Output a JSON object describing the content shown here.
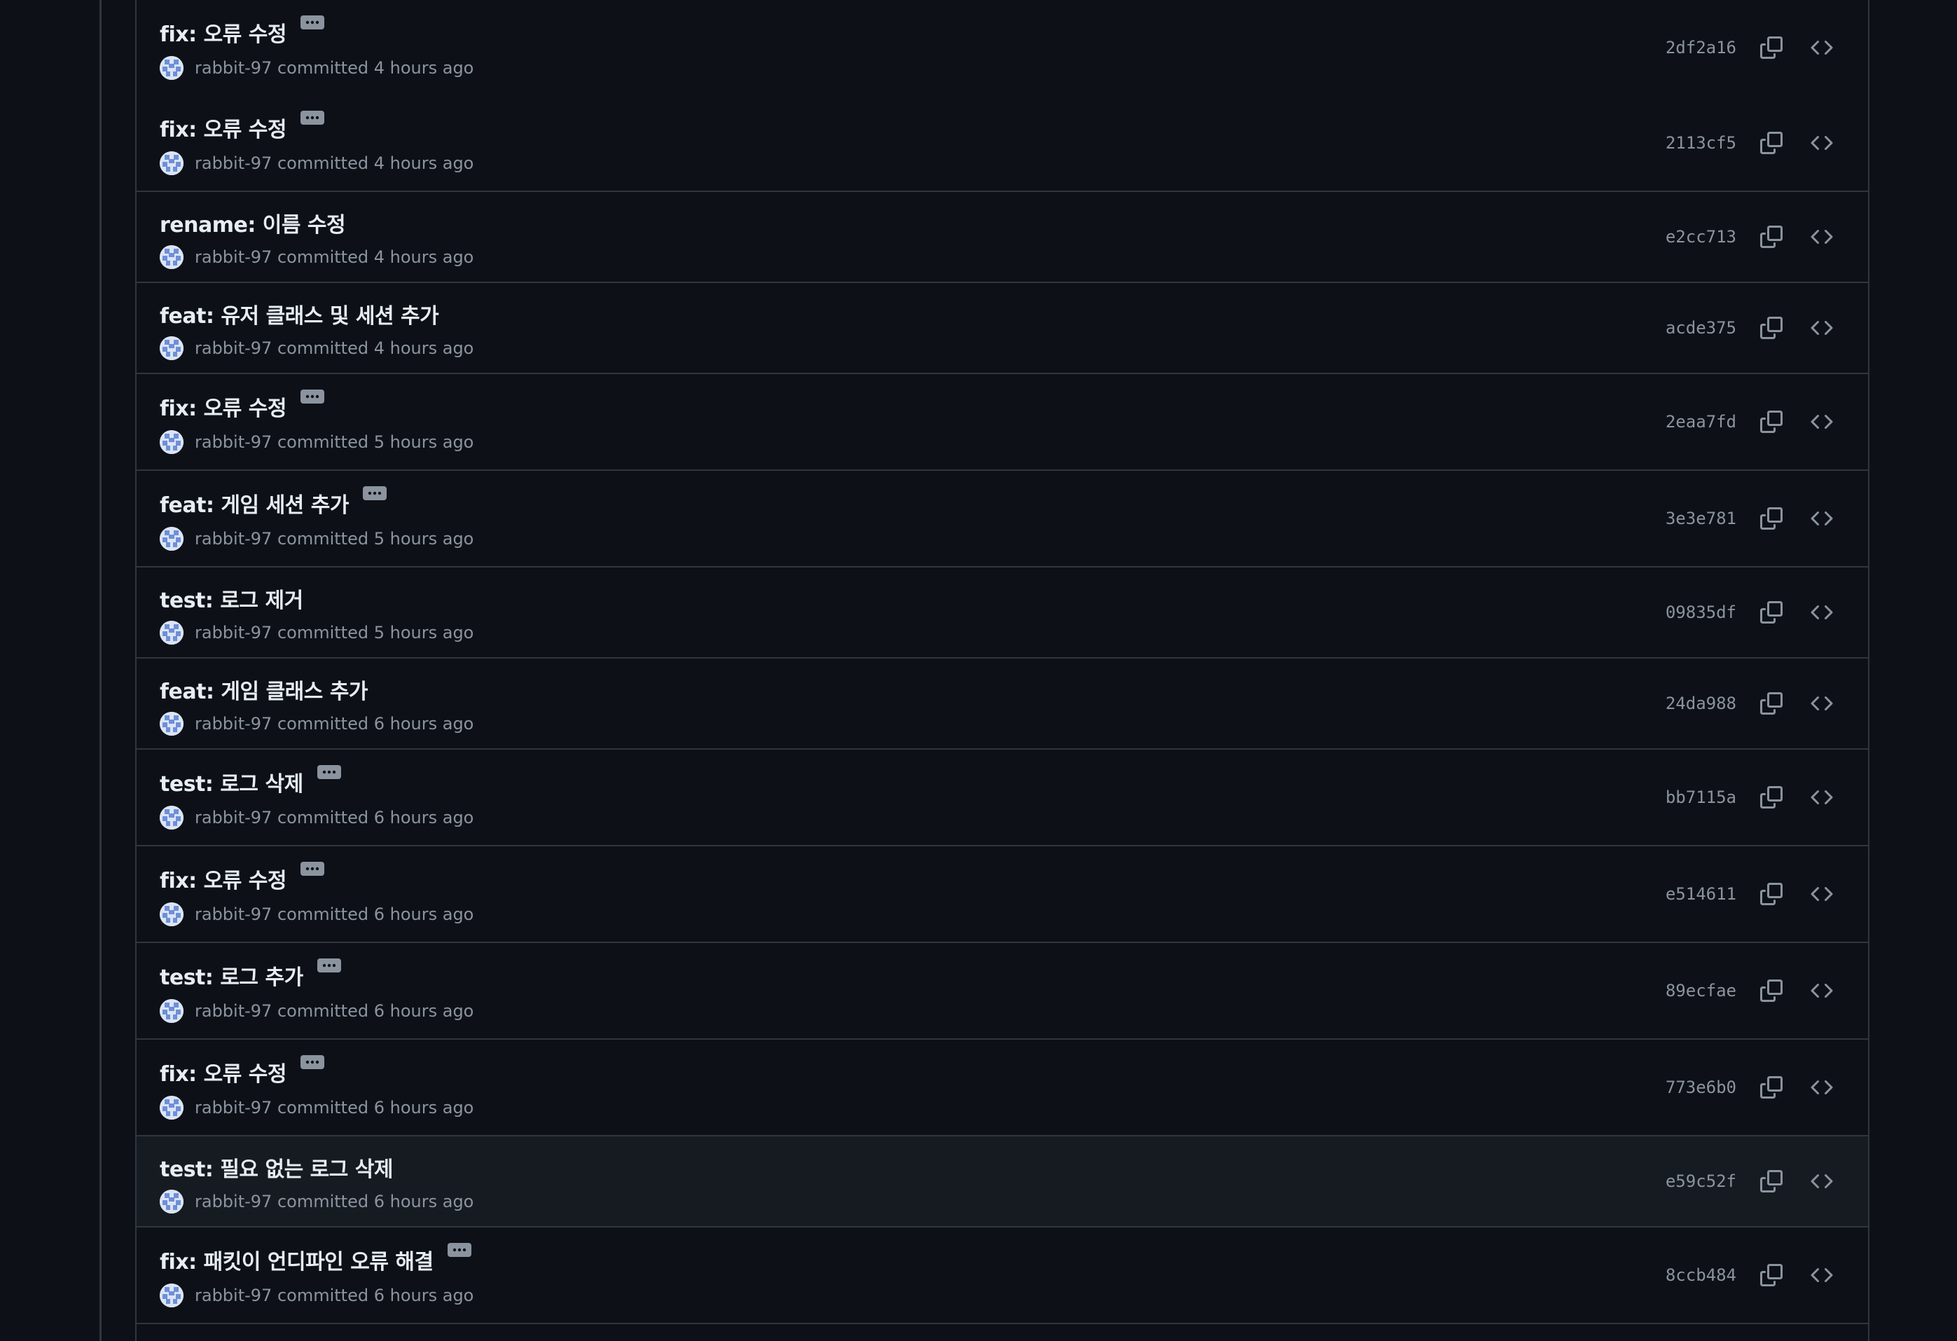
{
  "commits": [
    {
      "message": "fix: 오류 수정",
      "has_more": true,
      "author": "rabbit-97",
      "verb": "committed",
      "time": "4 hours ago",
      "sha": "2df2a16"
    },
    {
      "message": "fix: 오류 수정",
      "has_more": true,
      "author": "rabbit-97",
      "verb": "committed",
      "time": "4 hours ago",
      "sha": "2113cf5"
    },
    {
      "message": "rename: 이름 수정",
      "has_more": false,
      "author": "rabbit-97",
      "verb": "committed",
      "time": "4 hours ago",
      "sha": "e2cc713"
    },
    {
      "message": "feat: 유저 클래스 및 세션 추가",
      "has_more": false,
      "author": "rabbit-97",
      "verb": "committed",
      "time": "4 hours ago",
      "sha": "acde375"
    },
    {
      "message": "fix: 오류 수정",
      "has_more": true,
      "author": "rabbit-97",
      "verb": "committed",
      "time": "5 hours ago",
      "sha": "2eaa7fd"
    },
    {
      "message": "feat: 게임 세션 추가",
      "has_more": true,
      "author": "rabbit-97",
      "verb": "committed",
      "time": "5 hours ago",
      "sha": "3e3e781"
    },
    {
      "message": "test: 로그 제거",
      "has_more": false,
      "author": "rabbit-97",
      "verb": "committed",
      "time": "5 hours ago",
      "sha": "09835df"
    },
    {
      "message": "feat: 게임 클래스 추가",
      "has_more": false,
      "author": "rabbit-97",
      "verb": "committed",
      "time": "6 hours ago",
      "sha": "24da988"
    },
    {
      "message": "test: 로그 삭제",
      "has_more": true,
      "author": "rabbit-97",
      "verb": "committed",
      "time": "6 hours ago",
      "sha": "bb7115a"
    },
    {
      "message": "fix: 오류 수정",
      "has_more": true,
      "author": "rabbit-97",
      "verb": "committed",
      "time": "6 hours ago",
      "sha": "e514611"
    },
    {
      "message": "test: 로그 추가",
      "has_more": true,
      "author": "rabbit-97",
      "verb": "committed",
      "time": "6 hours ago",
      "sha": "89ecfae"
    },
    {
      "message": "fix: 오류 수정",
      "has_more": true,
      "author": "rabbit-97",
      "verb": "committed",
      "time": "6 hours ago",
      "sha": "773e6b0"
    },
    {
      "message": "test: 필요 없는 로그 삭제",
      "has_more": false,
      "author": "rabbit-97",
      "verb": "committed",
      "time": "6 hours ago",
      "sha": "e59c52f",
      "hovered": true
    },
    {
      "message": "fix: 패킷이 언디파인 오류 해결",
      "has_more": true,
      "author": "rabbit-97",
      "verb": "committed",
      "time": "6 hours ago",
      "sha": "8ccb484"
    }
  ],
  "colors": {
    "background": "#0d1117",
    "row_hover": "#161b22",
    "border": "#30363d",
    "title_text": "#e6edf3",
    "muted_text": "#8b949e"
  },
  "icons": {
    "more": "kebab-horizontal-icon",
    "avatar": "identicon-avatar",
    "copy": "copy-icon",
    "browse": "code-icon"
  }
}
